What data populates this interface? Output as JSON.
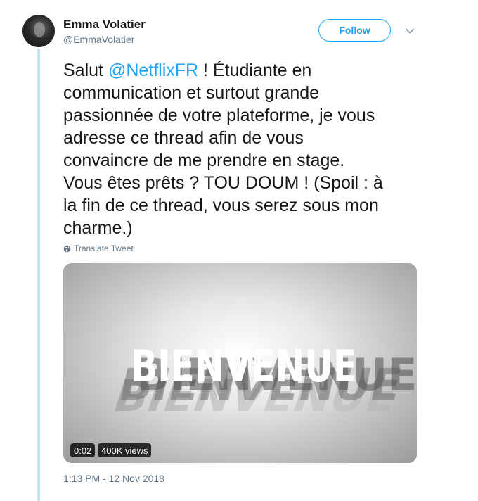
{
  "author": {
    "name": "Emma Volatier",
    "handle": "@EmmaVolatier"
  },
  "follow_label": "Follow",
  "tweet": {
    "before_mention": "Salut ",
    "mention": "@NetflixFR",
    "after_mention": " ! Étudiante en\ncommunication et surtout grande\npassionnée de votre plateforme, je vous\nadresse ce thread afin de vous\nconvaincre de me prendre en stage.\nVous êtes prêts ? TOU DOUM ! (Spoil : à\nla fin de ce thread, vous serez sous mon\ncharme.)"
  },
  "translate_label": "Translate Tweet",
  "media": {
    "overlay_text": "BIENVENUE",
    "duration": "0:02",
    "views": "400K views"
  },
  "timestamp": "1:13 PM - 12 Nov 2018",
  "colors": {
    "accent": "#1da1f2",
    "thread_line": "#c4e4f7",
    "secondary_text": "#657786"
  },
  "icons": {
    "caret": "chevron-down-icon",
    "translate": "globe-icon"
  }
}
